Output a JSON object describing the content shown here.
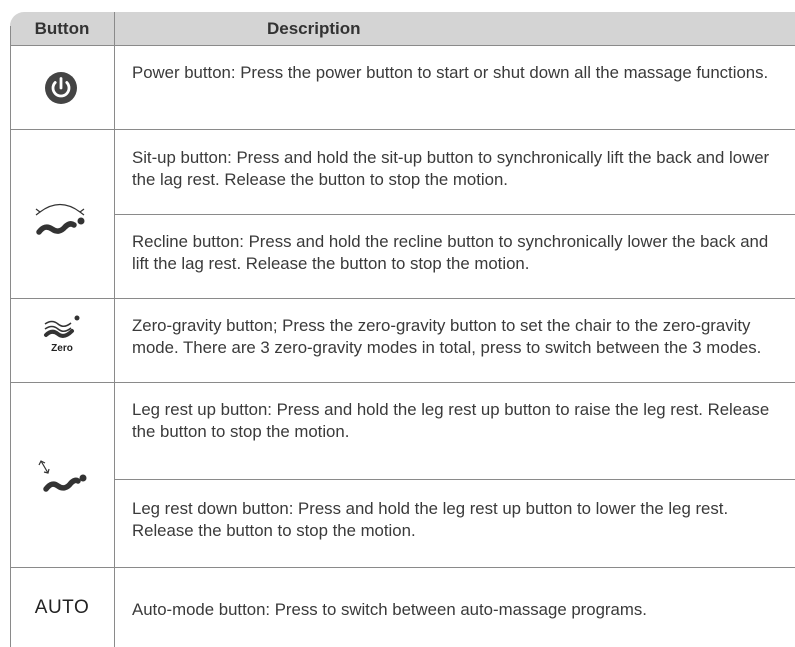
{
  "header": {
    "button": "Button",
    "description": "Description"
  },
  "rows": [
    {
      "icon": "power-icon",
      "text": "Power button: Press the power button to start or shut down all the massage functions."
    },
    {
      "icon": "sit-up-recline-icon",
      "text": "Sit-up button: Press and hold the sit-up button to synchronically lift the back and lower the lag rest. Release the button to stop the motion."
    },
    {
      "icon": "sit-up-recline-icon",
      "text": "Recline button: Press and hold the recline button to synchronically lower the back and lift the lag rest. Release the button to stop the motion."
    },
    {
      "icon": "zero-gravity-icon",
      "icon_label": "Zero",
      "text": "Zero-gravity button; Press the zero-gravity button to set the chair to the zero-gravity mode. There are 3 zero-gravity modes in total, press to switch between the 3 modes."
    },
    {
      "icon": "leg-rest-icon",
      "text": "Leg rest up button: Press and hold the leg rest up button to raise the leg rest. Release the button to stop the motion."
    },
    {
      "icon": "leg-rest-icon",
      "text": "Leg rest down button: Press and hold the leg rest up button to lower the leg rest. Release the button to stop the motion."
    },
    {
      "icon": "auto-label",
      "icon_label": "AUTO",
      "text": "Auto-mode button: Press to switch between auto-massage programs."
    }
  ],
  "colors": {
    "header_bg": "#d4d4d4",
    "rule": "#8a8a8a",
    "icon_dark": "#444444"
  }
}
